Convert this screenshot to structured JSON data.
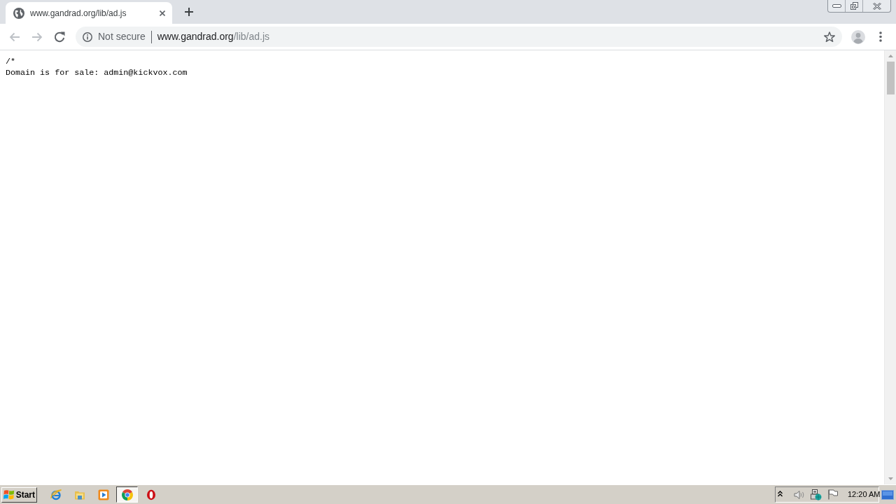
{
  "browser": {
    "tabs": [
      {
        "title": "www.gandrad.org/lib/ad.js",
        "selected": true
      }
    ],
    "toolbar": [
      {
        "kind": "back",
        "disabled": true
      },
      {
        "kind": "forward",
        "disabled": true
      },
      {
        "kind": "reload",
        "disabled": false
      }
    ],
    "address_bar": {
      "security": "Not secure",
      "url_host": "www.gandrad.org",
      "url_path": "/lib/ad.js"
    }
  },
  "page": {
    "lines": [
      "/*",
      "Domain is for sale: admin@kickvox.com"
    ]
  },
  "taskbar": {
    "start": "Start",
    "apps": [
      {
        "kind": "ie",
        "active": false
      },
      {
        "kind": "folder",
        "active": false
      },
      {
        "kind": "media",
        "active": false
      },
      {
        "kind": "chrome",
        "active": true
      },
      {
        "kind": "opera",
        "active": false
      }
    ],
    "clock": "12:20 AM"
  }
}
